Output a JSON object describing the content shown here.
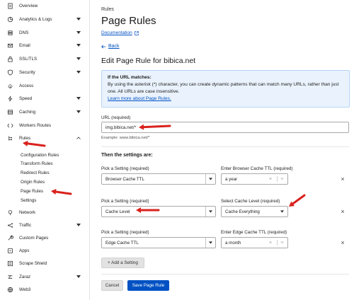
{
  "sidebar": {
    "items": [
      {
        "label": "Overview",
        "icon": "document-icon",
        "chevron": false
      },
      {
        "label": "Analytics & Logs",
        "icon": "analytics-icon",
        "chevron": true
      },
      {
        "label": "DNS",
        "icon": "dns-icon",
        "chevron": true
      },
      {
        "label": "Email",
        "icon": "email-icon",
        "chevron": true
      },
      {
        "label": "SSL/TLS",
        "icon": "lock-icon",
        "chevron": true
      },
      {
        "label": "Security",
        "icon": "shield-icon",
        "chevron": true
      },
      {
        "label": "Access",
        "icon": "access-icon",
        "chevron": false
      },
      {
        "label": "Speed",
        "icon": "speed-icon",
        "chevron": true
      },
      {
        "label": "Caching",
        "icon": "caching-icon",
        "chevron": true
      },
      {
        "label": "Workers Routes",
        "icon": "workers-icon",
        "chevron": false
      },
      {
        "label": "Rules",
        "icon": "rules-icon",
        "chevron": true
      },
      {
        "label": "Network",
        "icon": "network-icon",
        "chevron": false
      },
      {
        "label": "Traffic",
        "icon": "traffic-icon",
        "chevron": true
      },
      {
        "label": "Custom Pages",
        "icon": "wrench-icon",
        "chevron": false
      },
      {
        "label": "Apps",
        "icon": "apps-icon",
        "chevron": false
      },
      {
        "label": "Scrape Shield",
        "icon": "scrape-shield-icon",
        "chevron": false
      },
      {
        "label": "Zaraz",
        "icon": "zaraz-icon",
        "chevron": true
      },
      {
        "label": "Web3",
        "icon": "web3-icon",
        "chevron": false
      }
    ],
    "rules_subitems": [
      "Configuration Rules",
      "Transform Rules",
      "Redirect Rules",
      "Origin Rules",
      "Page Rules",
      "Settings"
    ]
  },
  "main": {
    "breadcrumb": "Rules",
    "title": "Page Rules",
    "documentation_link": "Documentation",
    "back_link": "Back",
    "edit_title": "Edit Page Rule for bibica.net",
    "info": {
      "heading": "If the URL matches:",
      "text": "By using the asterisk (*) character, you can create dynamic patterns that can match many URLs, rather than just one. All URLs are case insensitive.",
      "link": "Learn more about Page Rules."
    },
    "url_label": "URL (required)",
    "url_value": "img.bibica.net/*",
    "url_hint": "Example: www.bibica.net/*",
    "settings_title": "Then the settings are:",
    "settings": [
      {
        "setting_label": "Pick a Setting (required)",
        "setting_value": "Browser Cache TTL",
        "value_label": "Enter Browser Cache TTL (required)",
        "value": "a year",
        "remove": "×"
      },
      {
        "setting_label": "Pick a Setting (required)",
        "setting_value": "Cache Level",
        "value_label": "Select Cache Level (required)",
        "value": "Cache Everything",
        "remove": "×"
      },
      {
        "setting_label": "Pick a Setting (required)",
        "setting_value": "Edge Cache TTL",
        "value_label": "Enter Edge Cache TTL (required)",
        "value": "a month",
        "remove": "×"
      }
    ],
    "add_setting_button": "+ Add a Setting",
    "cancel_button": "Cancel",
    "save_button": "Save Page Rule"
  },
  "colors": {
    "link": "#0051c3",
    "annotation_arrow": "#d9221d",
    "info_bg": "#eaf3fd"
  }
}
